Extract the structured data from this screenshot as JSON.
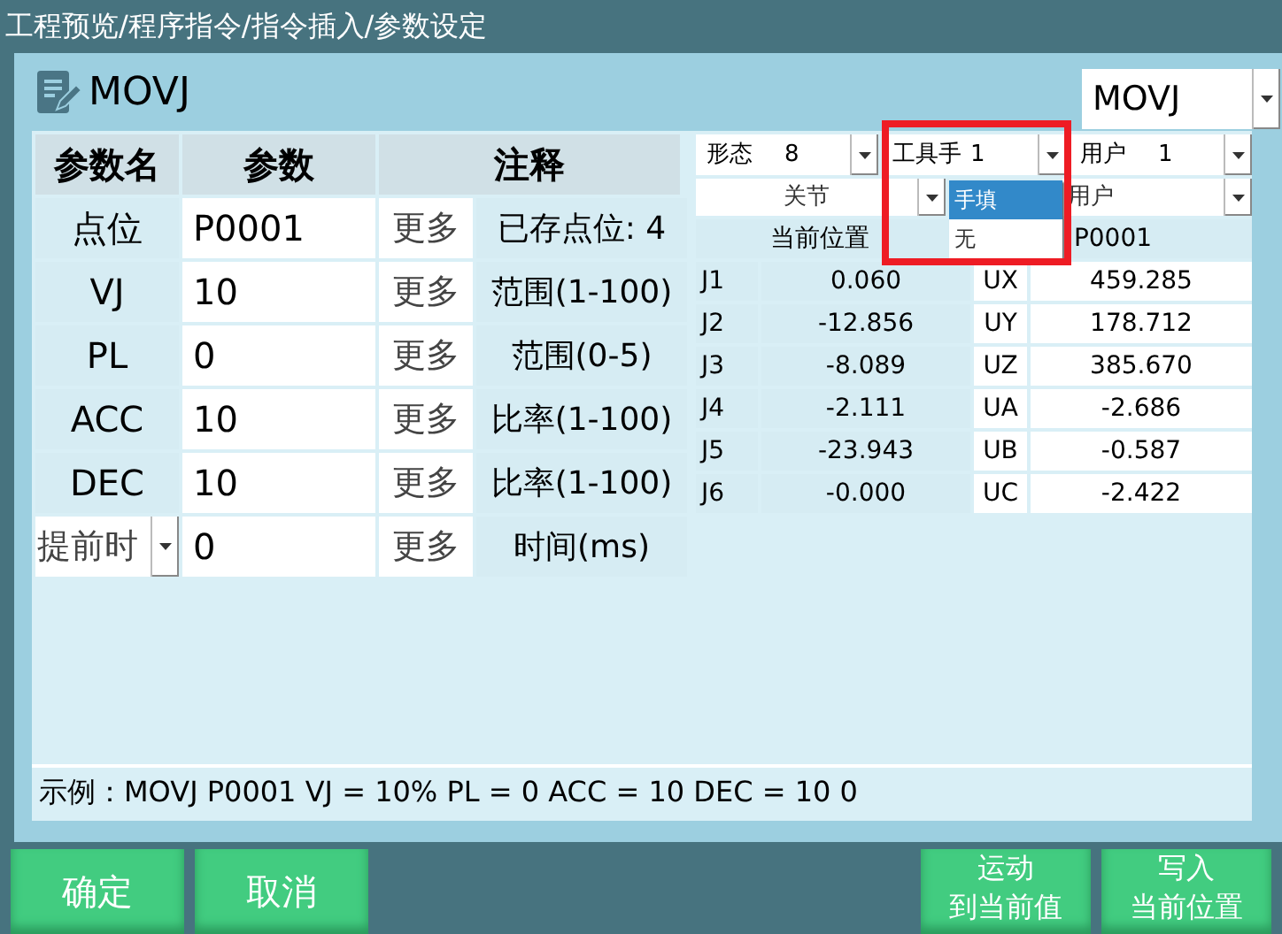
{
  "window": {
    "title": "工程预览/程序指令/指令插入/参数设定"
  },
  "header": {
    "title": "MOVJ",
    "command_select": "MOVJ"
  },
  "param_table": {
    "columns": [
      "参数名",
      "参数",
      "注释"
    ],
    "rows": [
      {
        "kind": "label",
        "name": "点位",
        "value": "P0001",
        "more": "更多",
        "note": "已存点位: 4"
      },
      {
        "kind": "label",
        "name": "VJ",
        "value": "10",
        "more": "更多",
        "note": "范围(1-100)"
      },
      {
        "kind": "label",
        "name": "PL",
        "value": "0",
        "more": "更多",
        "note": "范围(0-5)"
      },
      {
        "kind": "label",
        "name": "ACC",
        "value": "10",
        "more": "更多",
        "note": "比率(1-100)"
      },
      {
        "kind": "label",
        "name": "DEC",
        "value": "10",
        "more": "更多",
        "note": "比率(1-100)"
      },
      {
        "kind": "select",
        "name": "提前时",
        "value": "0",
        "more": "更多",
        "note": "时间(ms)"
      }
    ]
  },
  "settings": [
    {
      "label": "形态",
      "value": "8"
    },
    {
      "label": "工具手",
      "value": "1"
    },
    {
      "label": "用户",
      "value": "1"
    }
  ],
  "frame_selects": [
    "关节",
    "用户"
  ],
  "position_table": {
    "header": [
      "当前位置",
      "P0001"
    ],
    "rows": [
      {
        "axis": "J1",
        "value": "0.060",
        "user_axis": "UX",
        "user_value": "459.285"
      },
      {
        "axis": "J2",
        "value": "-12.856",
        "user_axis": "UY",
        "user_value": "178.712"
      },
      {
        "axis": "J3",
        "value": "-8.089",
        "user_axis": "UZ",
        "user_value": "385.670"
      },
      {
        "axis": "J4",
        "value": "-2.111",
        "user_axis": "UA",
        "user_value": "-2.686"
      },
      {
        "axis": "J5",
        "value": "-23.943",
        "user_axis": "UB",
        "user_value": "-0.587"
      },
      {
        "axis": "J6",
        "value": "-0.000",
        "user_axis": "UC",
        "user_value": "-2.422"
      }
    ]
  },
  "dropdown_menu": {
    "options": [
      {
        "label": "手填",
        "selected": true
      },
      {
        "label": "无",
        "selected": false
      }
    ]
  },
  "example": "示例：MOVJ P0001 VJ = 10% PL = 0 ACC = 10 DEC = 10 0",
  "buttons_left": [
    "确定",
    "取消"
  ],
  "buttons_right": [
    [
      "运动",
      "到当前值"
    ],
    [
      "写入",
      "当前位置"
    ]
  ]
}
